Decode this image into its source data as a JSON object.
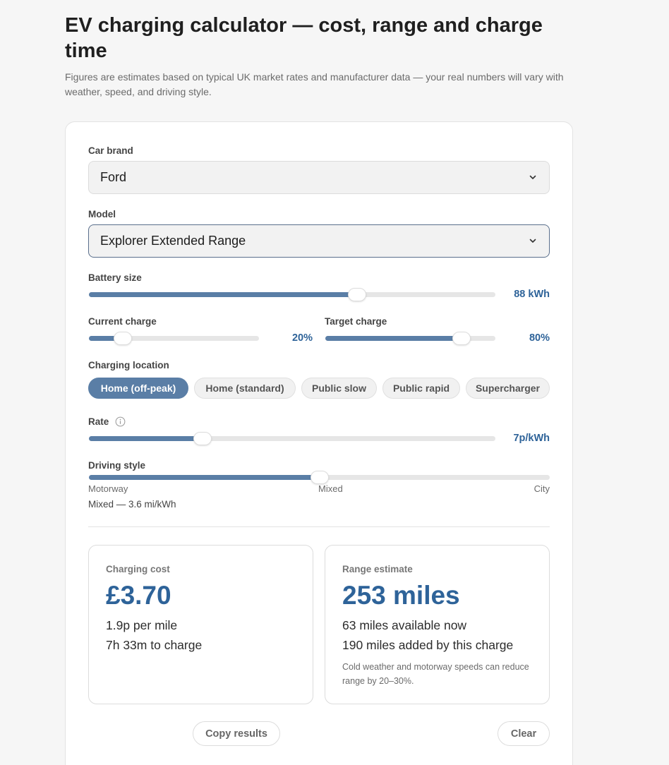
{
  "header": {
    "title": "EV charging calculator — cost, range and charge time",
    "subtitle": "Figures are estimates based on typical UK market rates and manufacturer data — your real numbers will vary with weather, speed, and driving style."
  },
  "form": {
    "brand": {
      "label": "Car brand",
      "value": "Ford",
      "icon": "chevron-down-icon"
    },
    "model": {
      "label": "Model",
      "value": "Explorer Extended Range",
      "icon": "chevron-down-icon"
    },
    "battery": {
      "label": "Battery size",
      "value_text": "88 kWh",
      "level": 0.66
    },
    "current_charge": {
      "label": "Current charge",
      "value_text": "20%",
      "level": 0.2
    },
    "target_charge": {
      "label": "Target charge",
      "value_text": "80%",
      "level": 0.8
    },
    "location": {
      "label": "Charging location",
      "options": [
        "Home (off-peak)",
        "Home (standard)",
        "Public slow",
        "Public rapid",
        "Supercharger"
      ],
      "selected": "Home (off-peak)"
    },
    "rate": {
      "label": "Rate",
      "value_text": "7p/kWh",
      "level": 0.28,
      "info_icon": "info-icon"
    },
    "driving_style": {
      "label": "Driving style",
      "level": 0.5,
      "left_label": "Motorway",
      "mid_label": "Mixed",
      "right_label": "City",
      "hint": "Mixed — 3.6 mi/kWh"
    }
  },
  "results": {
    "cost": {
      "label": "Charging cost",
      "amount": "£3.70",
      "line1": "1.9p per mile",
      "line2": "7h 33m to charge"
    },
    "range": {
      "label": "Range estimate",
      "amount": "253 miles",
      "line1": "63 miles available now",
      "line2": "190 miles added by this charge",
      "note": "Cold weather and motorway speeds can reduce range by 20–30%."
    }
  },
  "actions": {
    "copy": "Copy results",
    "clear": "Clear"
  },
  "colors": {
    "accent": "#5a7ea6",
    "value_text": "#2e6399",
    "track": "#e6e6e6"
  }
}
